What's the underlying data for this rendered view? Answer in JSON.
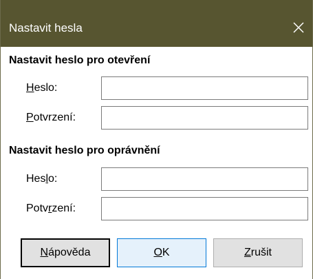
{
  "window": {
    "title": "Nastavit hesla",
    "close_icon": "close-icon"
  },
  "open_section": {
    "title": "Nastavit heslo pro otevření",
    "password_label": {
      "pre": "",
      "key": "H",
      "post": "eslo:"
    },
    "password_value": "",
    "confirm_label": {
      "pre": "",
      "key": "P",
      "post": "otvrzení:"
    },
    "confirm_value": ""
  },
  "edit_section": {
    "title": "Nastavit heslo pro oprávnění",
    "password_label": {
      "pre": "Hes",
      "key": "l",
      "post": "o:"
    },
    "password_value": "",
    "confirm_label": {
      "pre": "Potv",
      "key": "r",
      "post": "zení:"
    },
    "confirm_value": ""
  },
  "buttons": {
    "help": {
      "key": "N",
      "post": "ápověda"
    },
    "ok": {
      "key": "O",
      "post": "K"
    },
    "cancel": {
      "key": "Z",
      "post": "rušit"
    }
  },
  "colors": {
    "titlebar": "#575530",
    "default_button_border": "#0078d7",
    "default_button_fill": "#e5f1fb"
  }
}
